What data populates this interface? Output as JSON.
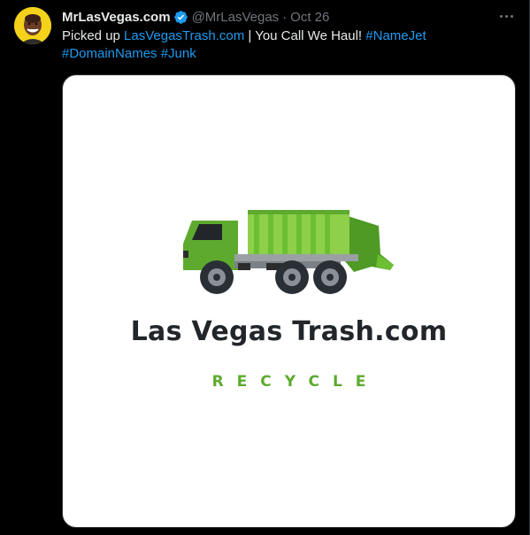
{
  "tweet": {
    "author": {
      "display_name": "MrLasVegas.com",
      "handle": "@MrLasVegas",
      "separator": "·",
      "date": "Oct 26",
      "verified_icon": "verified-badge-icon",
      "verified_color": "#1d9bf0"
    },
    "more_icon": "more-horizontal-icon",
    "text_segments": {
      "t1": "Picked up ",
      "link1": "LasVegasTrash.com",
      "t2": " | You Call We Haul! ",
      "tag1": "#NameJet",
      "tag2": "#DomainNames",
      "t3": " ",
      "tag3": "#Junk"
    },
    "colors": {
      "link": "#1d9bf0",
      "text": "#e7e9ea",
      "muted": "#71767b",
      "background": "#000000"
    },
    "media": {
      "logo_title": "Las Vegas Trash.com",
      "logo_subtitle": "RECYCLE",
      "logo_icon": "garbage-truck-icon",
      "truck_color": "#5eaa2e"
    }
  }
}
